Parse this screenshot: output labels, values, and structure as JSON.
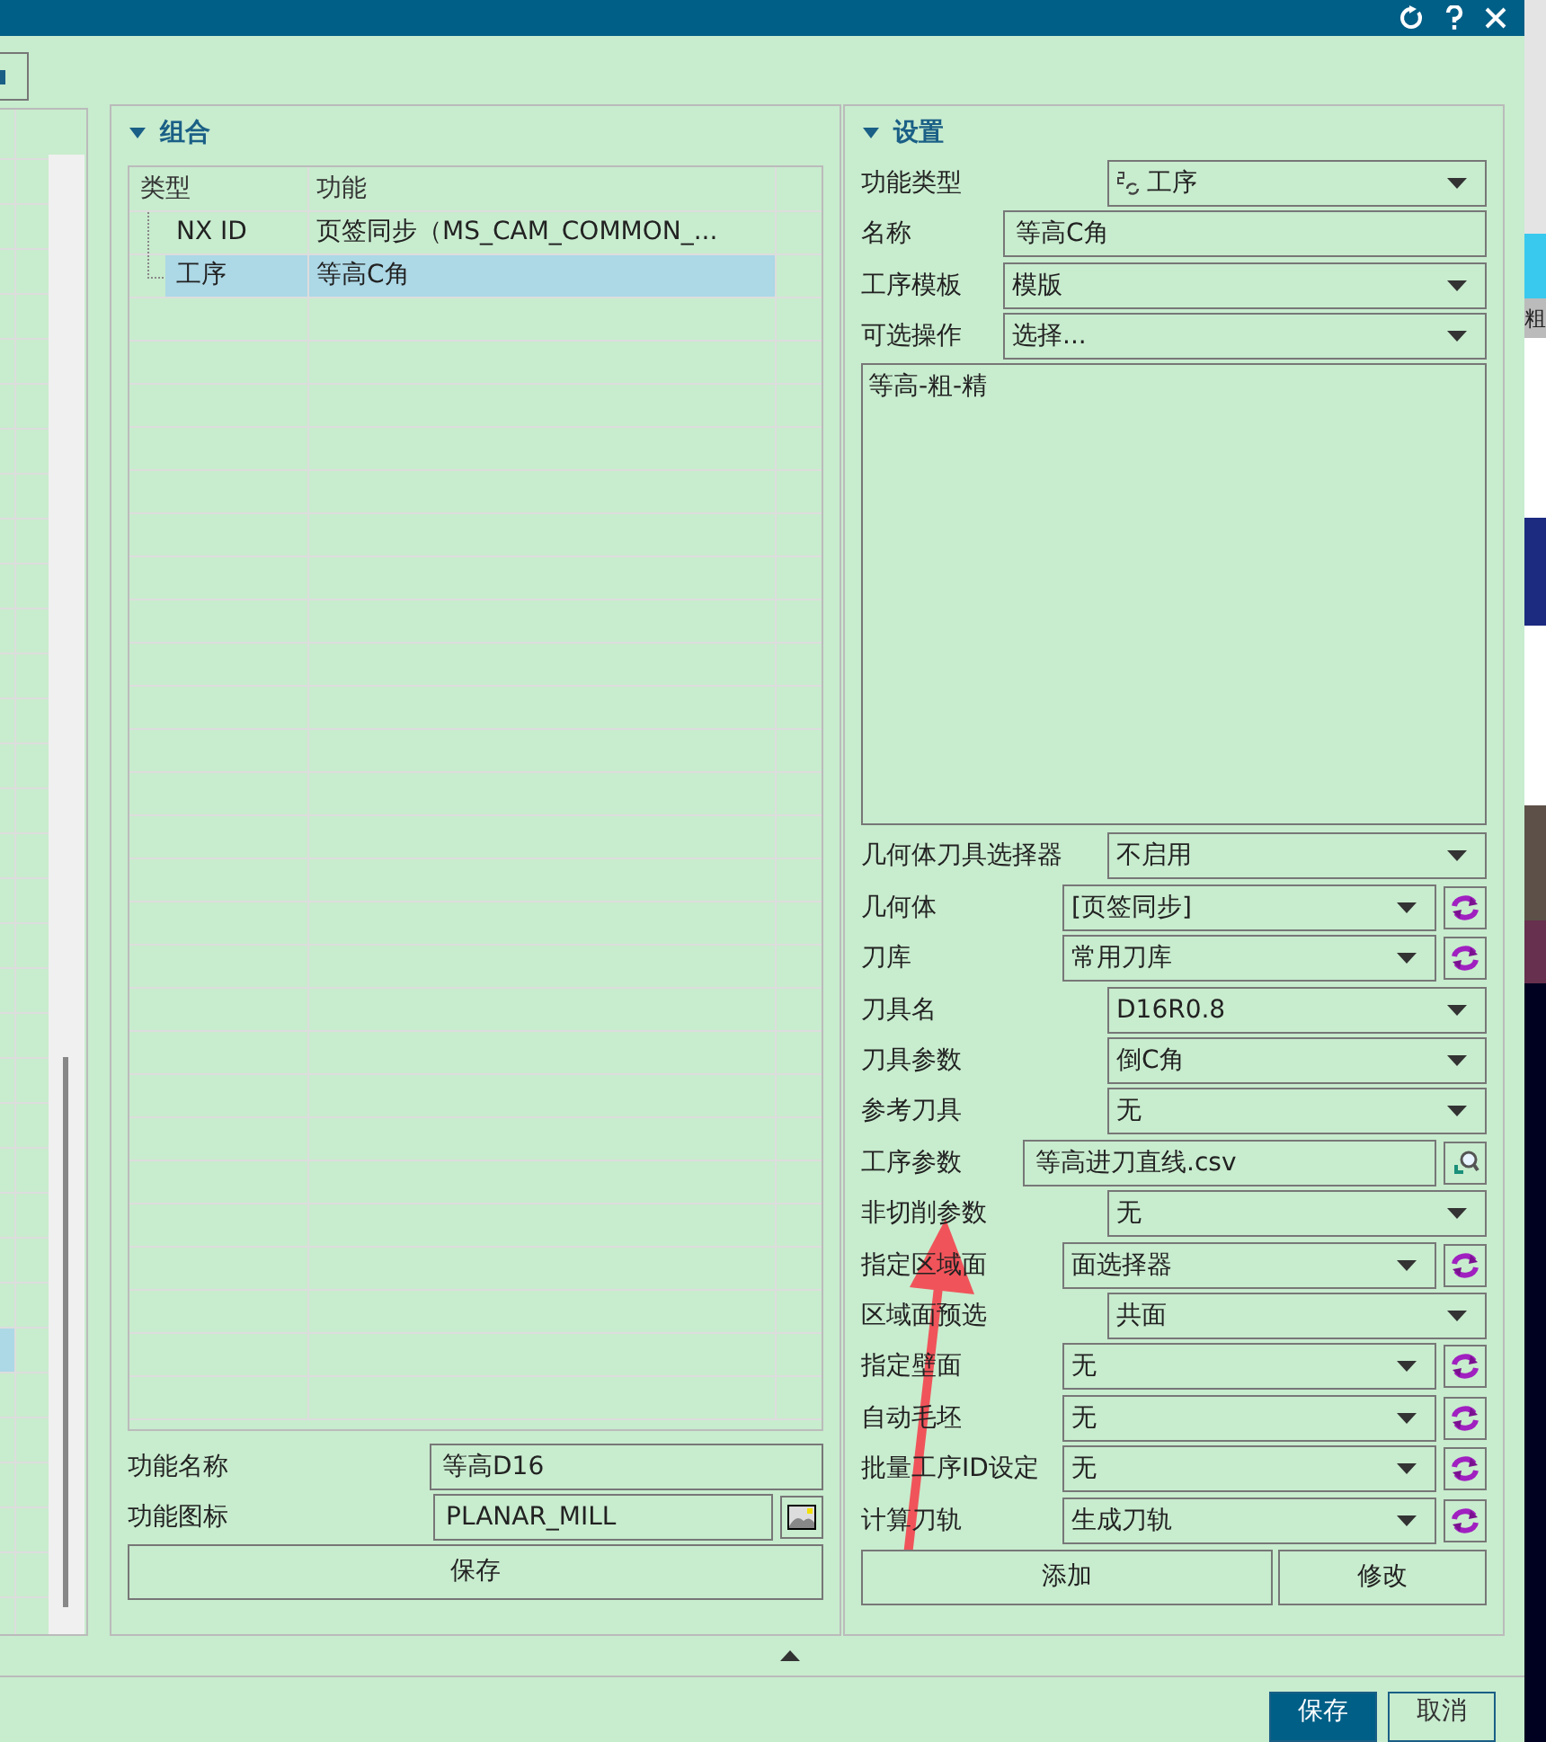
{
  "group_panel": {
    "title": "组合",
    "table": {
      "columns": [
        "类型",
        "功能"
      ],
      "rows": [
        {
          "type": "NX ID",
          "function": "页签同步（MS_CAM_COMMON_...",
          "selected": false
        },
        {
          "type": "工序",
          "function": "等高C角",
          "selected": true
        }
      ]
    },
    "function_name": {
      "label": "功能名称",
      "value": "等高D16"
    },
    "function_icon": {
      "label": "功能图标",
      "value": "PLANAR_MILL"
    },
    "save_button": "保存"
  },
  "settings_panel": {
    "title": "设置",
    "fields": [
      {
        "label": "功能类型",
        "kind": "select-icon",
        "value": "工序"
      },
      {
        "label": "名称",
        "kind": "text",
        "value": "等高C角"
      },
      {
        "label": "工序模板",
        "kind": "select-wide",
        "value": "模版"
      },
      {
        "label": "可选操作",
        "kind": "select-wide",
        "value": "选择..."
      },
      {
        "kind": "textarea",
        "value": "等高-粗-精"
      },
      {
        "label": "几何体刀具选择器",
        "kind": "select",
        "value": "不启用"
      },
      {
        "label": "几何体",
        "kind": "select-refresh",
        "value": "[页签同步]"
      },
      {
        "label": "刀库",
        "kind": "select-refresh",
        "value": "常用刀库"
      },
      {
        "label": "刀具名",
        "kind": "select",
        "value": "D16R0.8"
      },
      {
        "label": "刀具参数",
        "kind": "select",
        "value": "倒C角"
      },
      {
        "label": "参考刀具",
        "kind": "select",
        "value": "无"
      },
      {
        "label": "工序参数",
        "kind": "text-search",
        "value": "等高进刀直线.csv"
      },
      {
        "label": "非切削参数",
        "kind": "select",
        "value": "无"
      },
      {
        "label": "指定区域面",
        "kind": "select-refresh",
        "value": "面选择器"
      },
      {
        "label": "区域面预选",
        "kind": "select",
        "value": "共面"
      },
      {
        "label": "指定壁面",
        "kind": "select-refresh",
        "value": "无"
      },
      {
        "label": "自动毛坯",
        "kind": "select-refresh",
        "value": "无"
      },
      {
        "label": "批量工序ID设定",
        "kind": "select-refresh",
        "value": "无"
      },
      {
        "label": "计算刀轨",
        "kind": "select-refresh",
        "value": "生成刀轨"
      }
    ],
    "buttons": [
      "添加",
      "修改"
    ]
  },
  "background_strip": {
    "text": "粗"
  },
  "dialog_buttons": [
    {
      "label": "保存",
      "primary": true
    },
    {
      "label": "取消",
      "primary": false
    }
  ]
}
